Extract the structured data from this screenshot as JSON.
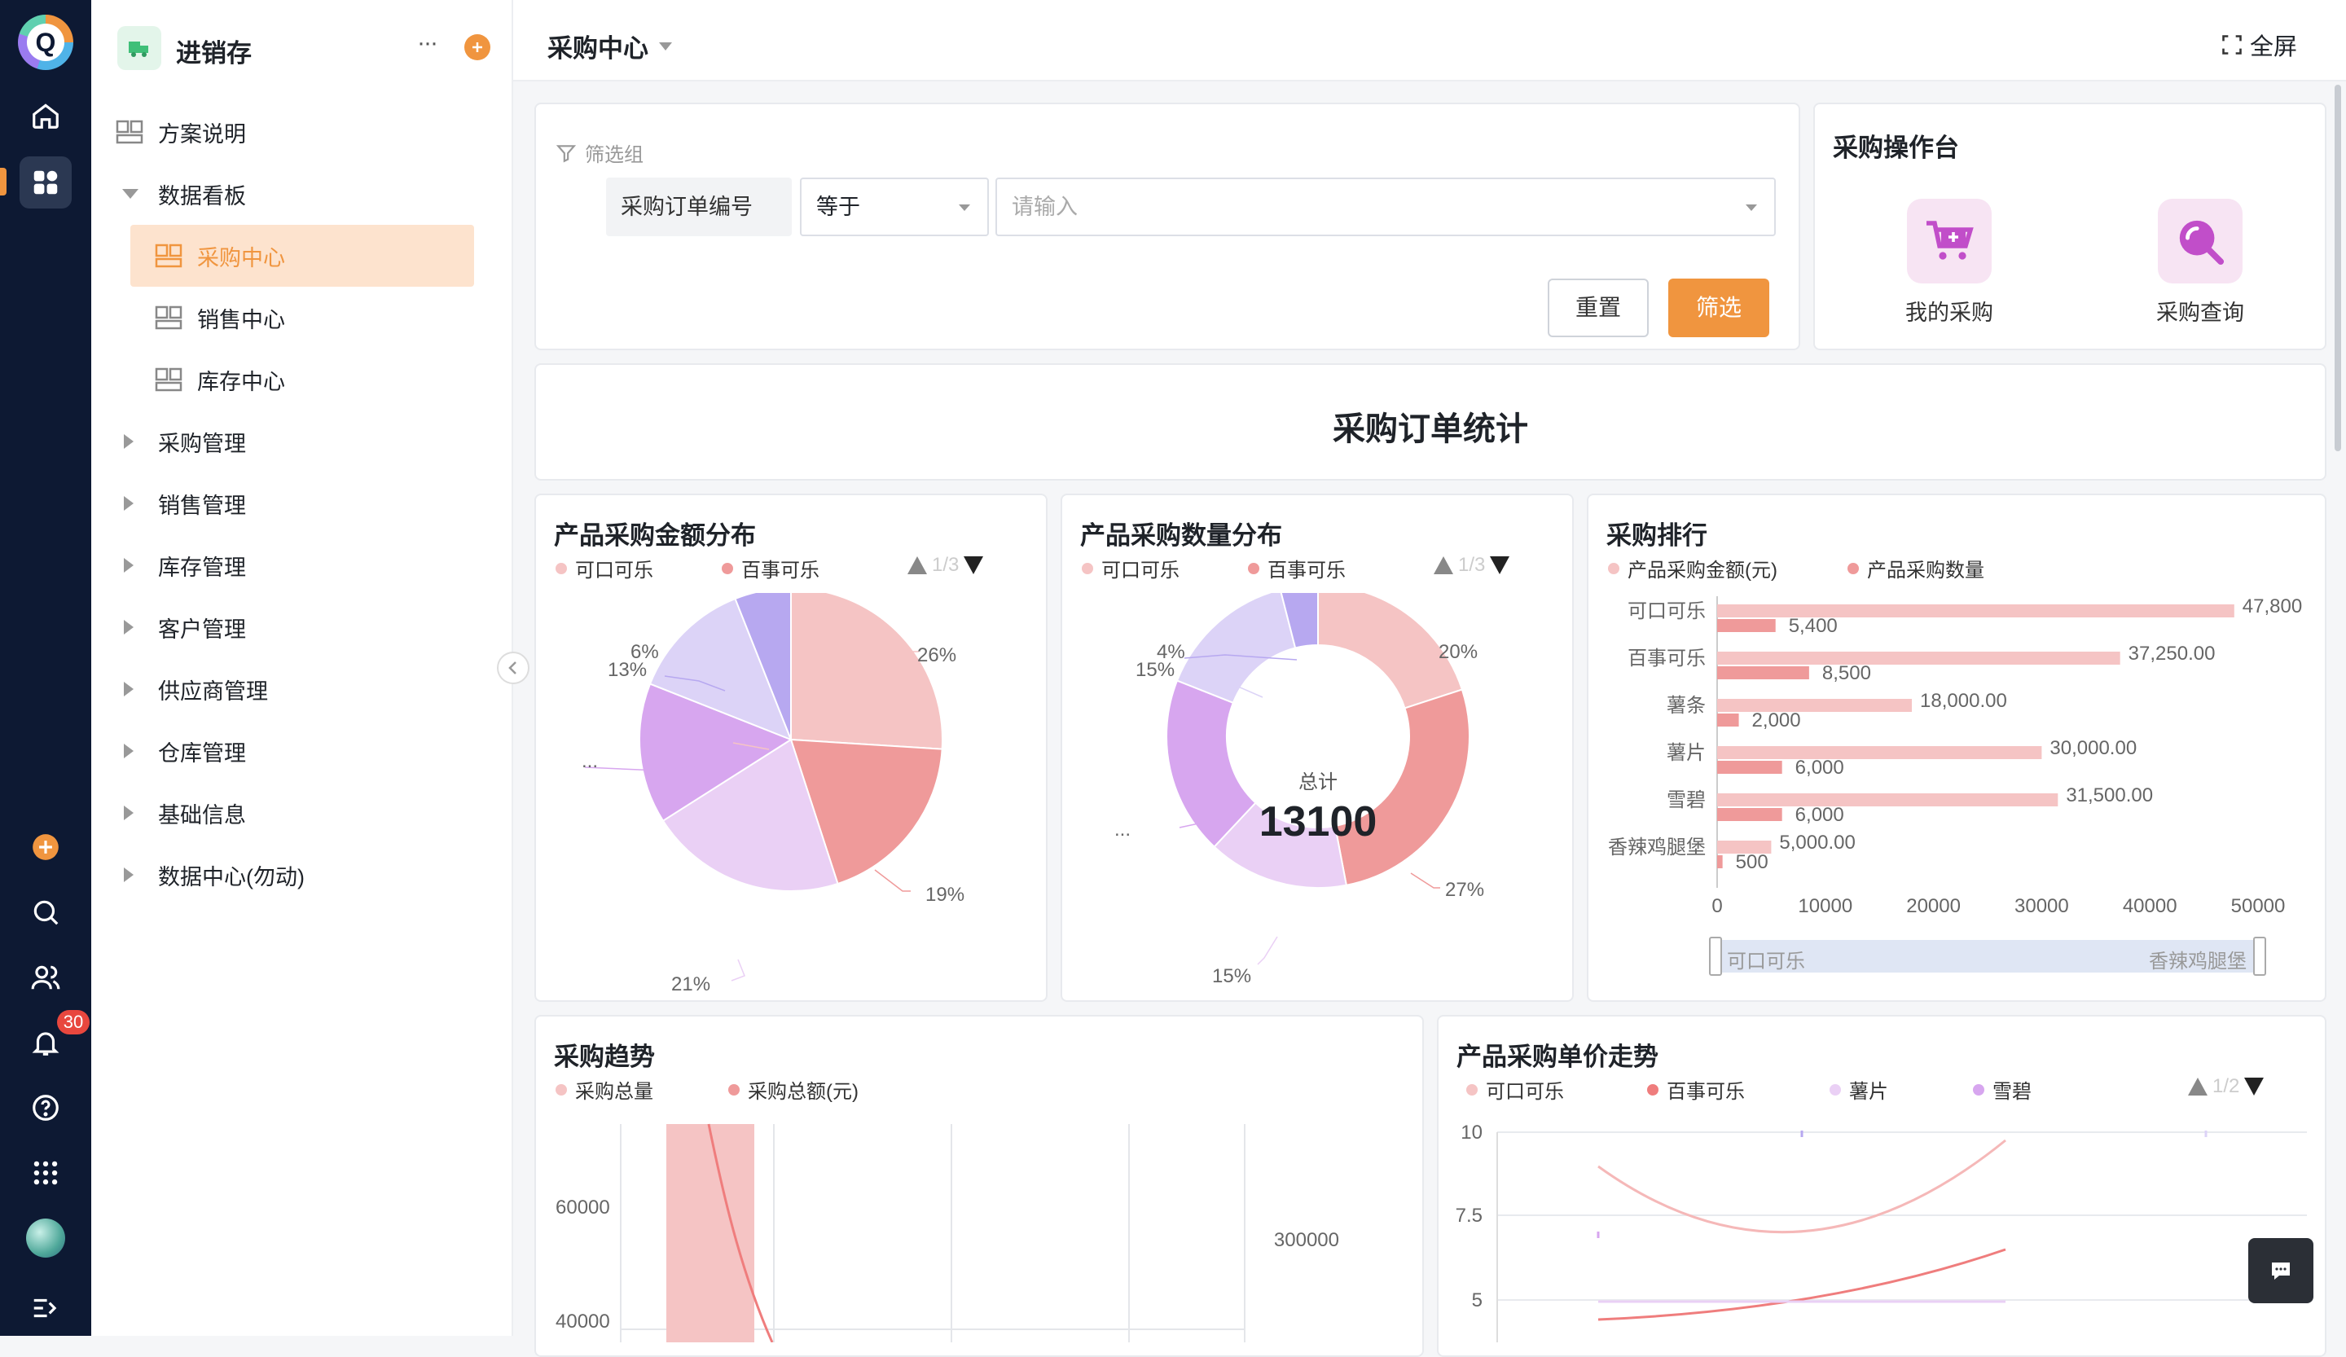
{
  "app": {
    "logo_letter": "Q",
    "notification_count": "30"
  },
  "sidebar": {
    "app_name": "进销存",
    "more": "···",
    "items": [
      {
        "label": "方案说明"
      },
      {
        "label": "数据看板"
      },
      {
        "label": "采购中心"
      },
      {
        "label": "销售中心"
      },
      {
        "label": "库存中心"
      },
      {
        "label": "采购管理"
      },
      {
        "label": "销售管理"
      },
      {
        "label": "库存管理"
      },
      {
        "label": "客户管理"
      },
      {
        "label": "供应商管理"
      },
      {
        "label": "仓库管理"
      },
      {
        "label": "基础信息"
      },
      {
        "label": "数据中心(勿动)"
      }
    ]
  },
  "header": {
    "title": "采购中心",
    "fullscreen": "全屏"
  },
  "filter": {
    "group_label": "筛选组",
    "field_label": "采购订单编号",
    "operator": "等于",
    "placeholder": "请输入",
    "reset": "重置",
    "apply": "筛选"
  },
  "ops": {
    "title": "采购操作台",
    "my_purchase": "我的采购",
    "purchase_query": "采购查询"
  },
  "stats_title": "采购订单统计",
  "colors": {
    "accent": "#f0953f",
    "pink1": "#f5c4c4",
    "pink2": "#ef9a9a",
    "lav1": "#ead0f5",
    "lav2": "#d7a6ef",
    "lav3": "#dcd3f7",
    "lav4": "#b7a8f0"
  },
  "amount_pie": {
    "title": "产品采购金额分布",
    "legend": [
      "可口可乐",
      "百事可乐"
    ],
    "page": "1/3",
    "labels": {
      "p26": "26%",
      "p19": "19%",
      "p21": "21%",
      "p13": "13%",
      "p6": "6%",
      "more": "..."
    },
    "chart_data": {
      "type": "pie",
      "values": [
        26,
        19,
        21,
        15,
        13,
        6
      ]
    }
  },
  "qty_pie": {
    "title": "产品采购数量分布",
    "legend": [
      "可口可乐",
      "百事可乐"
    ],
    "page": "1/3",
    "total_label": "总计",
    "total_value": "13100",
    "labels": {
      "p20": "20%",
      "p27": "27%",
      "p15b": "15%",
      "p15": "15%",
      "p4": "4%",
      "more": "..."
    },
    "chart_data": {
      "type": "pie",
      "values": [
        20,
        27,
        15,
        19,
        15,
        4
      ]
    }
  },
  "ranking": {
    "title": "采购排行",
    "legend": [
      "产品采购金额(元)",
      "产品采购数量"
    ],
    "chart_data": {
      "type": "bar",
      "categories": [
        "可口可乐",
        "百事可乐",
        "薯条",
        "薯片",
        "雪碧",
        "香辣鸡腿堡"
      ],
      "series": [
        {
          "name": "产品采购金额(元)",
          "values": [
            47800,
            37250,
            18000,
            30000,
            31500,
            5000
          ]
        },
        {
          "name": "产品采购数量",
          "values": [
            5400,
            8500,
            2000,
            6000,
            6000,
            500
          ]
        }
      ],
      "value_labels_amount": [
        "47,800",
        "37,250.00",
        "18,000.00",
        "30,000.00",
        "31,500.00",
        "5,000.00"
      ],
      "value_labels_qty": [
        "5,400",
        "8,500",
        "2,000",
        "6,000",
        "6,000",
        "500"
      ],
      "xlim": [
        0,
        50000
      ],
      "xticks": [
        "0",
        "10000",
        "20000",
        "30000",
        "40000",
        "50000"
      ]
    },
    "slider_start": "可口可乐",
    "slider_end": "香辣鸡腿堡"
  },
  "trend": {
    "title": "采购趋势",
    "legend": [
      "采购总量",
      "采购总额(元)"
    ],
    "yticks_left": [
      "60000",
      "40000"
    ],
    "yticks_right": [
      "300000"
    ]
  },
  "price_trend": {
    "title": "产品采购单价走势",
    "legend": [
      "可口可乐",
      "百事可乐",
      "薯片",
      "雪碧"
    ],
    "page": "1/2",
    "yticks": [
      "10",
      "7.5",
      "5"
    ]
  }
}
